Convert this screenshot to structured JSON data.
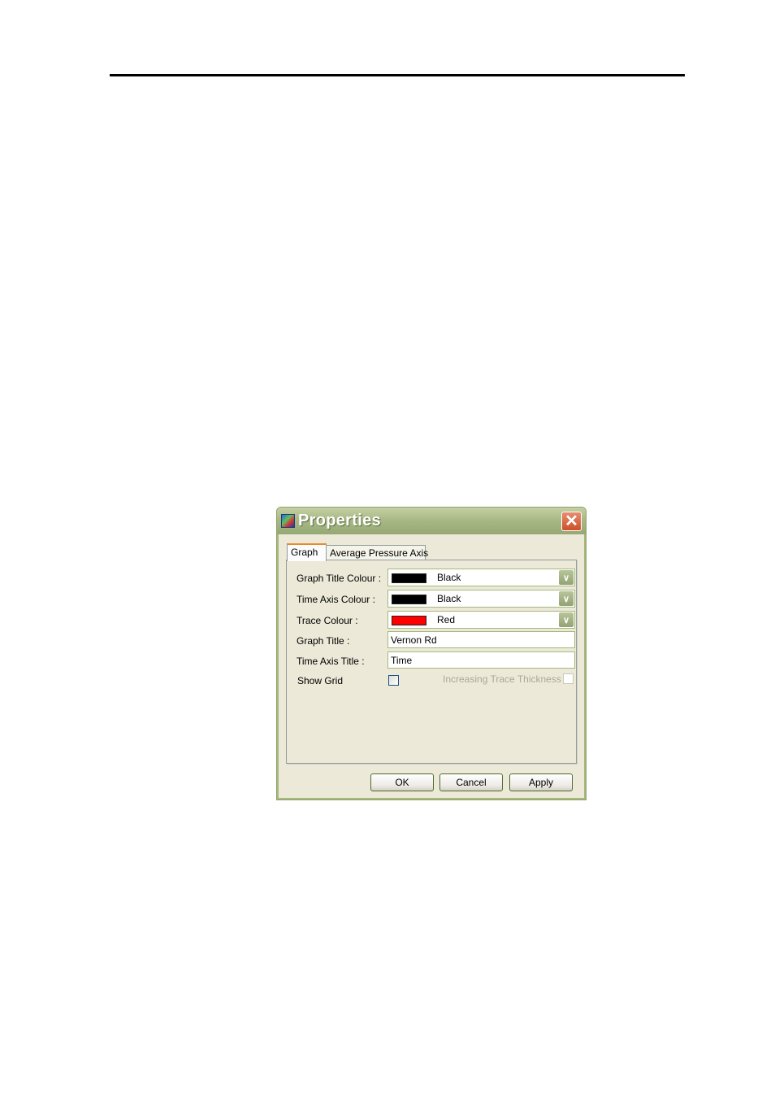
{
  "dialog": {
    "title": "Properties",
    "close_label": "✕",
    "tabs": [
      {
        "label": "Graph",
        "active": true
      },
      {
        "label": "Average Pressure Axis",
        "active": false
      }
    ],
    "fields": {
      "graph_title_colour": {
        "label": "Graph Title Colour :",
        "value": "Black",
        "color": "#000000"
      },
      "time_axis_colour": {
        "label": "Time Axis Colour :",
        "value": "Black",
        "color": "#000000"
      },
      "trace_colour": {
        "label": "Trace Colour :",
        "value": "Red",
        "color": "#ff0000"
      },
      "graph_title": {
        "label": "Graph Title :",
        "value": "Vernon Rd"
      },
      "time_axis_title": {
        "label": "Time Axis Title :",
        "value": "Time"
      },
      "show_grid": {
        "label": "Show Grid",
        "checked": false
      },
      "increasing_trace_thickness": {
        "label": "Increasing Trace Thickness",
        "checked": false,
        "disabled": true
      }
    },
    "buttons": {
      "ok": "OK",
      "cancel": "Cancel",
      "apply": "Apply"
    }
  }
}
